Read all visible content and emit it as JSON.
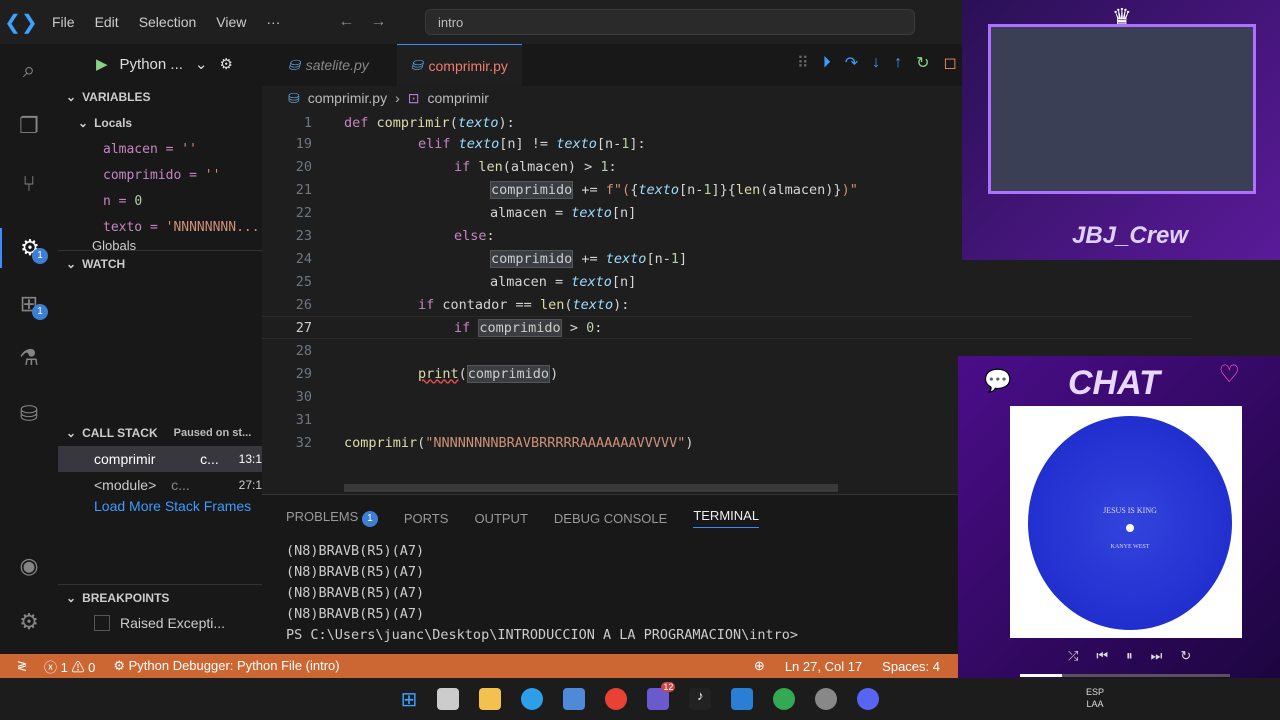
{
  "menu": {
    "file": "File",
    "edit": "Edit",
    "selection": "Selection",
    "view": "View",
    "more": "···"
  },
  "search": {
    "value": "intro"
  },
  "run": {
    "config": "Python ..."
  },
  "tabs": [
    {
      "label": "satelite.py"
    },
    {
      "label": "comprimir.py"
    }
  ],
  "breadcrumb": {
    "file": "comprimir.py",
    "symbol": "comprimir"
  },
  "variables": {
    "header": "VARIABLES",
    "locals": "Locals",
    "items": [
      {
        "name": "almacen",
        "value": "''"
      },
      {
        "name": "comprimido",
        "value": "''"
      },
      {
        "name": "n",
        "value": "0"
      },
      {
        "name": "texto",
        "value": "'NNNNNNNN..."
      }
    ],
    "globals": "Globals"
  },
  "watch": {
    "header": "WATCH"
  },
  "callstack": {
    "header": "CALL STACK",
    "status": "Paused on st...",
    "frames": [
      {
        "name": "comprimir",
        "file": "c...",
        "pos": "13:1"
      },
      {
        "name": "<module>",
        "file": "c...",
        "pos": "27:1"
      }
    ],
    "more": "Load More Stack Frames"
  },
  "breakpoints": {
    "header": "BREAKPOINTS",
    "items": [
      "Raised Excepti..."
    ]
  },
  "code": [
    {
      "n": "1",
      "t": "def comprimir(texto):"
    },
    {
      "n": "19",
      "t": "elif texto[n] != texto[n-1]:"
    },
    {
      "n": "20",
      "t": "if len(almacen) > 1:"
    },
    {
      "n": "21",
      "t": "comprimido += f\"({texto[n-1]}{len(almacen)})\""
    },
    {
      "n": "22",
      "t": "almacen = texto[n]"
    },
    {
      "n": "23",
      "t": "else:"
    },
    {
      "n": "24",
      "t": "comprimido += texto[n-1]"
    },
    {
      "n": "25",
      "t": "almacen = texto[n]"
    },
    {
      "n": "26",
      "t": "if contador == len(texto):"
    },
    {
      "n": "27",
      "t": "if comprimido > 0:"
    },
    {
      "n": "28",
      "t": ""
    },
    {
      "n": "29",
      "t": "print(comprimido)"
    },
    {
      "n": "30",
      "t": ""
    },
    {
      "n": "31",
      "t": ""
    },
    {
      "n": "32",
      "t": "comprimir(\"NNNNNNNNBRAVBRRRRRAAAAAAAVVVVV\")"
    }
  ],
  "panel": {
    "problems": "PROBLEMS",
    "problems_count": "1",
    "ports": "PORTS",
    "output": "OUTPUT",
    "debug": "DEBUG CONSOLE",
    "terminal": "TERMINAL"
  },
  "terminal": [
    "(N8)BRAVB(R5)(A7)",
    "(N8)BRAVB(R5)(A7)",
    "(N8)BRAVB(R5)(A7)",
    "(N8)BRAVB(R5)(A7)",
    "PS C:\\Users\\juanc\\Desktop\\INTRODUCCION A LA PROGRAMACION\\intro> "
  ],
  "status": {
    "errors": "1",
    "warnings": "0",
    "debugger": "Python Debugger: Python File (intro)",
    "position": "Ln 27, Col 17",
    "spaces": "Spaces: 4"
  },
  "activity_badges": {
    "debug": "1",
    "extensions": "1"
  },
  "overlay": {
    "crew": "JBJ_Crew",
    "chat": "CHAT",
    "album_title": "JESUS IS KING",
    "album_artist": "KANYE WEST"
  },
  "taskbar": {
    "chat_badge": "12",
    "lang": "ESP",
    "region": "LAA"
  }
}
